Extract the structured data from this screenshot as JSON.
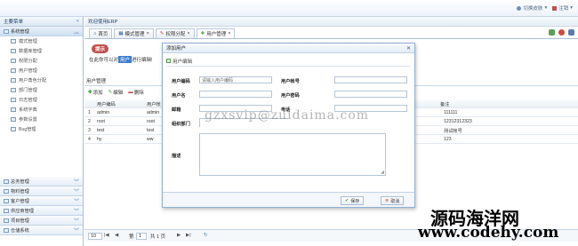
{
  "topbar": {
    "switch_theme": "切换皮肤",
    "logout": "注销"
  },
  "sidebar": {
    "title": "主要菜单",
    "group_system": "系统管理",
    "items": [
      {
        "label": "模式管理",
        "icon": "grid-icon"
      },
      {
        "label": "数据库管理",
        "icon": "database-icon"
      },
      {
        "label": "权限分配",
        "icon": "key-icon"
      },
      {
        "label": "用户管理",
        "icon": "user-icon"
      },
      {
        "label": "用户角色分配",
        "icon": "user-role-icon"
      },
      {
        "label": "部门管理",
        "icon": "department-icon"
      },
      {
        "label": "日志管理",
        "icon": "log-icon"
      },
      {
        "label": "系统字典",
        "icon": "dictionary-icon"
      },
      {
        "label": "参数设置",
        "icon": "settings-icon"
      },
      {
        "label": "Bug管理",
        "icon": "bug-icon"
      }
    ],
    "groups": [
      "总务管理",
      "物料管理",
      "客户管理",
      "供应商管理",
      "项目管理",
      "仓储系统"
    ]
  },
  "main": {
    "welcome": "欢迎使用ERP",
    "tabs": [
      "首页",
      "模式管理",
      "权限分配",
      "用户管理"
    ],
    "tip_badge": "提示",
    "tip_text_a": "在此你可以对",
    "tip_highlight": "用户",
    "tip_text_b": "进行编辑!",
    "section_title": "用户管理",
    "toolbar": {
      "add": "添加",
      "edit": "编辑",
      "delete": "删除"
    },
    "columns": [
      "用户编码",
      "用户帐",
      "备注"
    ],
    "rows": [
      {
        "n": "1",
        "code": "admin",
        "acct": "admin",
        "note": "111111"
      },
      {
        "n": "2",
        "code": "root",
        "acct": "root",
        "note": "12312312323"
      },
      {
        "n": "3",
        "code": "test",
        "acct": "test",
        "note": "测试帐号"
      },
      {
        "n": "4",
        "code": "hy",
        "acct": "ww",
        "note": "123"
      }
    ],
    "pager": {
      "page_size": "10",
      "page_label": "第",
      "page_no": "1",
      "page_total": "共 1 页"
    }
  },
  "dialog": {
    "title": "添加用户",
    "subtitle": "用户编辑",
    "fields": {
      "code_label": "用户编码",
      "code_placeholder": "请输入用户编码",
      "acct_label": "用户帐号",
      "name_label": "用户名",
      "pwd_label": "用户密码",
      "email_label": "邮箱",
      "phone_label": "电话",
      "dept_label": "组织部门",
      "desc_label": "描述"
    },
    "save": "保存",
    "cancel": "取消"
  },
  "watermark": {
    "url_top": "gzxsvip@zuidaima.com",
    "brand": "源码海洋网",
    "site": "www.codehy.com"
  },
  "colors": {
    "accent": "#2a5a9a",
    "header_bg": "#e3ecf6",
    "tip_badge": "#c0504d",
    "highlight": "#3f7fd0"
  }
}
